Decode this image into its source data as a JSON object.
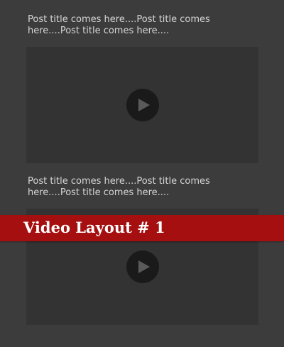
{
  "posts": [
    {
      "title": "Post title comes here....Post title comes here....Post title comes here...."
    },
    {
      "title": "Post title comes here....Post title comes here....Post title comes here...."
    }
  ],
  "banner": {
    "label": "Video Layout # 1"
  },
  "icons": {
    "play": "play-icon"
  },
  "colors": {
    "background": "#3c3c3c",
    "video_panel": "#333333",
    "play_button": "#1a1a1a",
    "play_glyph": "#5a5a5a",
    "title_text": "#d6d6d6",
    "banner": "#a50f0f",
    "banner_text": "#ffffff"
  }
}
